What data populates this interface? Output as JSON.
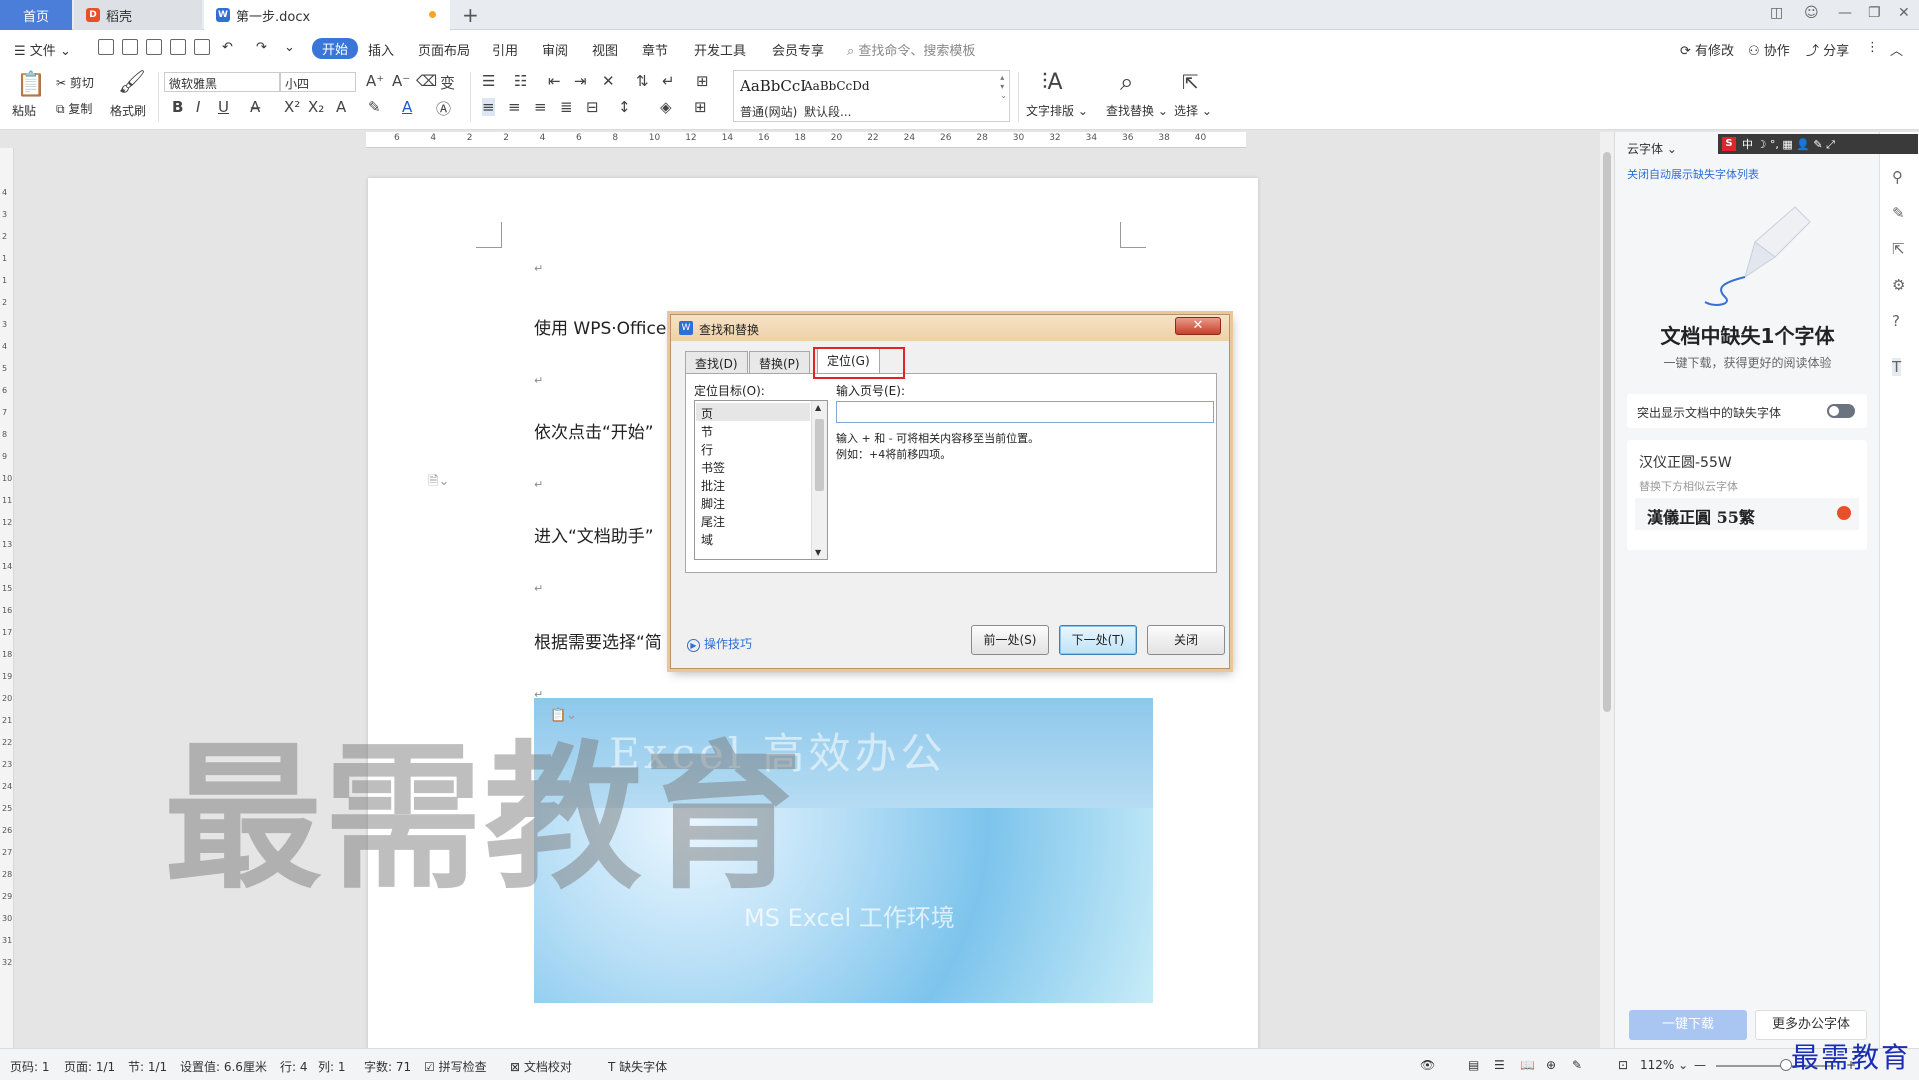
{
  "tabs": {
    "home": "首页",
    "daoke": "稻壳",
    "doc": "第一步.docx",
    "doc_icon": "W",
    "add": "+"
  },
  "menu": {
    "file": "文件",
    "start": "开始",
    "items": [
      "插入",
      "页面布局",
      "引用",
      "审阅",
      "视图",
      "章节",
      "开发工具",
      "会员专享"
    ],
    "search": "查找命令、搜索模板",
    "has_changes": "有修改",
    "collab": "协作",
    "share": "分享"
  },
  "ribbon": {
    "paste": "粘贴",
    "cut": "剪切",
    "copy": "复制",
    "format_painter": "格式刷",
    "font_name": "微软雅黑",
    "font_size": "小四",
    "style_normal_preview": "AaBbCcI",
    "style_normal": "普通(网站)",
    "style_default_preview": "AaBbCcDd",
    "style_default": "默认段...",
    "text_layout": "文字排版",
    "find_replace": "查找替换",
    "select": "选择"
  },
  "ruler": {
    "h_ticks": [
      "6",
      "4",
      "2",
      "2",
      "4",
      "6",
      "8",
      "10",
      "12",
      "14",
      "16",
      "18",
      "20",
      "22",
      "24",
      "26",
      "28",
      "30",
      "32",
      "34",
      "36",
      "38",
      "40"
    ],
    "v_ticks": [
      "4",
      "3",
      "2",
      "1",
      "1",
      "2",
      "3",
      "4",
      "5",
      "6",
      "7",
      "8",
      "9",
      "10",
      "11",
      "12",
      "13",
      "14",
      "15",
      "16",
      "17",
      "18",
      "19",
      "20",
      "21",
      "22",
      "23",
      "24",
      "25",
      "26",
      "27",
      "28",
      "29",
      "30",
      "31",
      "32"
    ]
  },
  "document": {
    "para1": "使用 WPS·Office",
    "para2": "依次点击“开始”",
    "para3": "进入“文档助手”",
    "para4": "根据需要选择“简",
    "pmark": "↵",
    "banner_sub": "Excel 高效办公",
    "banner_mid": "MS Excel 工作环境",
    "watermark": "最需教育"
  },
  "dialog": {
    "title": "查找和替换",
    "title_icon": "W",
    "close": "✕",
    "tab_find": "查找(D)",
    "tab_replace": "替换(P)",
    "tab_goto": "定位(G)",
    "target_label": "定位目标(O):",
    "targets": [
      "页",
      "节",
      "行",
      "书签",
      "批注",
      "脚注",
      "尾注",
      "域"
    ],
    "page_label": "输入页号(E):",
    "page_value": "",
    "hint1": "输入 + 和 - 可将相关内容移至当前位置。",
    "hint2": "例如：+4将前移四项。",
    "tips": "操作技巧",
    "btn_prev": "前一处(S)",
    "btn_next": "下一处(T)",
    "btn_close": "关闭"
  },
  "rpanel": {
    "head": "云字体",
    "close_link": "关闭自动展示缺失字体列表",
    "missing_title": "文档中缺失1个字体",
    "missing_sub": "一键下载，获得更好的阅读体验",
    "highlight_label": "突出显示文档中的缺失字体",
    "font_name": "汉仪正圆-55W",
    "replace_hint": "替换下方相似云字体",
    "suggest_name": "漢儀正圓 55繁",
    "btn_download": "一键下载",
    "btn_more": "更多办公字体"
  },
  "ime": {
    "logo": "S",
    "text": "中 ☽ °, ▦ 👤 ✎ ⤢"
  },
  "status": {
    "page_code": "页码: 1",
    "page": "页面: 1/1",
    "section": "节: 1/1",
    "setting": "设置值: 6.6厘米",
    "row": "行: 4",
    "col": "列: 1",
    "words": "字数: 71",
    "spell": "拼写检查",
    "proof": "文档校对",
    "missing_font": "缺失字体",
    "zoom": "112%",
    "corner_logo": "最需教育"
  },
  "colors": {
    "accent": "#3a75d8",
    "highlight_red": "#e02424",
    "dialog_border": "#b8936a"
  }
}
